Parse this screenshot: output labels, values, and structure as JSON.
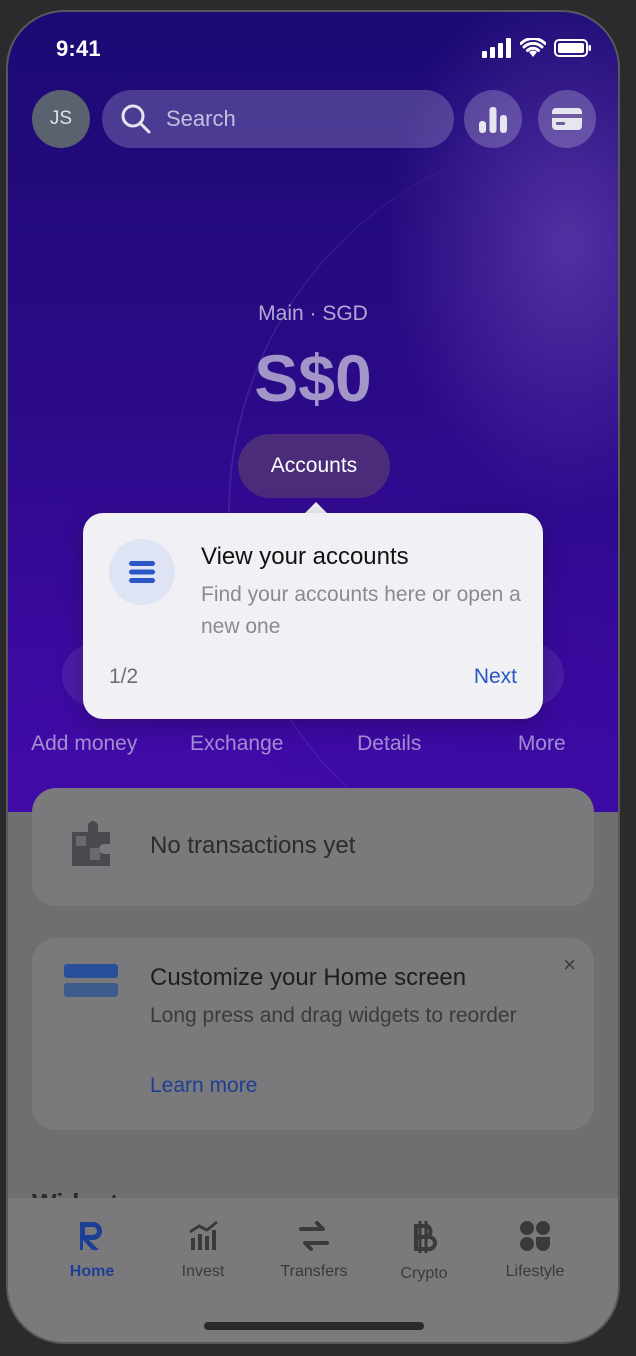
{
  "status_bar": {
    "time": "9:41"
  },
  "header": {
    "avatar_initials": "JS",
    "search_placeholder": "Search",
    "analytics_icon": "bar-chart-icon",
    "cards_icon": "card-icon"
  },
  "balance": {
    "label": "Main · SGD",
    "amount": "S$0",
    "accounts_button": "Accounts"
  },
  "actions": [
    {
      "label": "Add money"
    },
    {
      "label": "Exchange"
    },
    {
      "label": "Details"
    },
    {
      "label": "More"
    }
  ],
  "transactions": {
    "empty_text": "No transactions yet",
    "icon": "puzzle-icon"
  },
  "customize": {
    "title": "Customize your Home screen",
    "description": "Long press and drag widgets to reorder",
    "link": "Learn more",
    "close": "×"
  },
  "widgets": {
    "title": "Widgets"
  },
  "tabbar": [
    {
      "label": "Home",
      "icon": "revolut-r-icon",
      "active": true
    },
    {
      "label": "Invest",
      "icon": "invest-chart-icon",
      "active": false
    },
    {
      "label": "Transfers",
      "icon": "transfer-arrows-icon",
      "active": false
    },
    {
      "label": "Crypto",
      "icon": "bitcoin-icon",
      "active": false
    },
    {
      "label": "Lifestyle",
      "icon": "lifestyle-grid-icon",
      "active": false
    }
  ],
  "tooltip": {
    "title": "View your accounts",
    "description": "Find your accounts here or open a new one",
    "step": "1/2",
    "next": "Next"
  },
  "colors": {
    "accent": "#2856c6",
    "hero": "#2a0a86"
  }
}
